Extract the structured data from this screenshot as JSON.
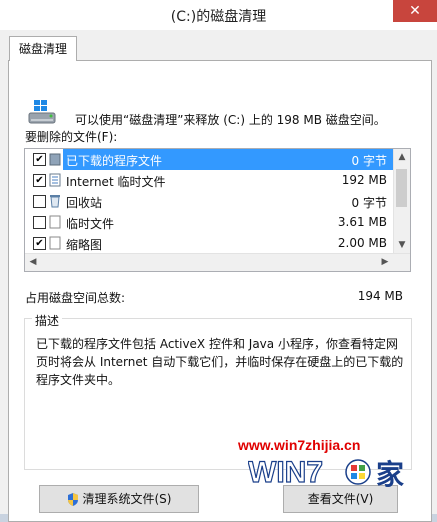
{
  "window": {
    "title": "(C:)的磁盘清理",
    "close_glyph": "✕"
  },
  "tab": {
    "label": "磁盘清理"
  },
  "summary": "可以使用“磁盘清理”来释放 (C:) 上的 198 MB 磁盘空间。",
  "files_label": "要删除的文件(F):",
  "files": [
    {
      "checked": true,
      "name": "已下载的程序文件",
      "size": "0 字节",
      "selected": true,
      "icon": "folder-icon"
    },
    {
      "checked": true,
      "name": "Internet 临时文件",
      "size": "192 MB",
      "selected": false,
      "icon": "document-icon"
    },
    {
      "checked": false,
      "name": "回收站",
      "size": "0 字节",
      "selected": false,
      "icon": "recycle-bin-icon"
    },
    {
      "checked": false,
      "name": "临时文件",
      "size": "3.61 MB",
      "selected": false,
      "icon": "file-icon"
    },
    {
      "checked": true,
      "name": "缩略图",
      "size": "2.00 MB",
      "selected": false,
      "icon": "file-icon"
    }
  ],
  "total": {
    "label": "占用磁盘空间总数:",
    "value": "194 MB"
  },
  "description": {
    "title": "描述",
    "text": "已下载的程序文件包括 ActiveX 控件和 Java 小程序，你查看特定网页时将会从 Internet 自动下载它们，并临时保存在硬盘上的已下载的程序文件夹中。"
  },
  "watermark": {
    "url": "www.win7zhijia.cn",
    "logo_text": "Win7之家"
  },
  "buttons": {
    "clean_system": "清理系统文件(S)",
    "view_files": "查看文件(V)"
  }
}
